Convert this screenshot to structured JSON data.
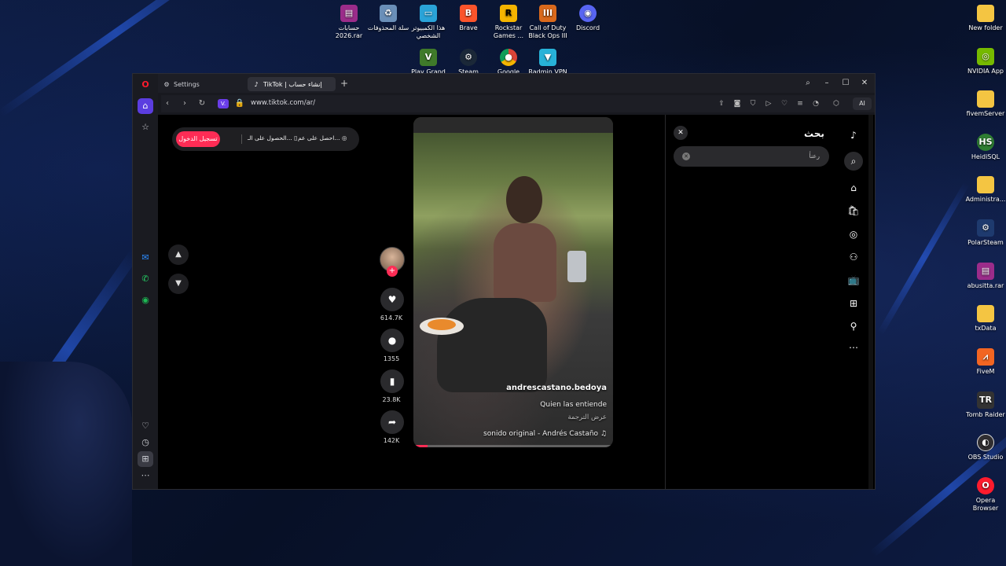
{
  "desktop": {
    "top_icons": [
      {
        "label": "حسابات 2026.rar",
        "icon": "winrar-icon",
        "color": "#9b2c8a"
      },
      {
        "label": "سلة المحذوفات",
        "icon": "recycle-bin-icon",
        "color": "#6a8fb8"
      },
      {
        "label": "هذا الكمبيوتر الشخصي",
        "icon": "this-pc-icon",
        "color": "#2aa3d8"
      },
      {
        "label": "Brave",
        "icon": "brave-icon",
        "color": "#fb542b"
      },
      {
        "label": "Rockstar Games ...",
        "icon": "rockstar-icon",
        "color": "#f5b400"
      },
      {
        "label": "Call of Duty Black Ops III",
        "icon": "cod-icon",
        "color": "#d9691c"
      },
      {
        "label": "Discord",
        "icon": "discord-icon",
        "color": "#5865f2"
      }
    ],
    "second_row_icons": [
      {
        "label": "Play Grand",
        "icon": "gta-icon",
        "color": "#3f7a2a"
      },
      {
        "label": "Steam",
        "icon": "steam-icon",
        "color": "#1b2838"
      },
      {
        "label": "Google",
        "icon": "chrome-icon",
        "color": "#db4437"
      },
      {
        "label": "Radmin VPN",
        "icon": "radmin-icon",
        "color": "#27b2d8"
      }
    ],
    "right_icons": [
      {
        "label": "New folder",
        "icon": "folder-icon",
        "color": "#f4c542"
      },
      {
        "label": "NVIDIA App",
        "icon": "nvidia-icon",
        "color": "#76b900"
      },
      {
        "label": "fivemServer",
        "icon": "folder-icon",
        "color": "#f4c542"
      },
      {
        "label": "HeidiSQL",
        "icon": "heidisql-icon",
        "color": "#2e7d32"
      },
      {
        "label": "Administra...",
        "icon": "folder-icon",
        "color": "#f4c542"
      },
      {
        "label": "PolarSteam",
        "icon": "polarsteam-icon",
        "color": "#1e3a6e"
      },
      {
        "label": "abusitta.rar",
        "icon": "winrar-icon",
        "color": "#9b2c8a"
      },
      {
        "label": "txData",
        "icon": "folder-icon",
        "color": "#f4c542"
      },
      {
        "label": "FiveM",
        "icon": "fivem-icon",
        "color": "#f26522"
      },
      {
        "label": "Tomb Raider",
        "icon": "tomb-raider-icon",
        "color": "#333333"
      },
      {
        "label": "OBS Studio",
        "icon": "obs-icon",
        "color": "#302e31"
      },
      {
        "label": "Opera Browser",
        "icon": "opera-icon",
        "color": "#ff1b2d"
      }
    ]
  },
  "browser": {
    "tabs": [
      {
        "label": "Settings",
        "icon": "gear-icon"
      },
      {
        "label": "TikTok | إنشاء حساب",
        "icon": "tiktok-icon"
      }
    ],
    "url": "www.tiktok.com/ar/",
    "url_badge": "V.",
    "ai_label": "AI"
  },
  "promo": {
    "login_label": "تسجيل الدخول",
    "item1": "الحصول على الـ...",
    "item2": "احصل على عم..."
  },
  "video": {
    "username": "andrescastano.bedoya",
    "caption": "Quien las entiende",
    "translate_label": "عرض الترجمة",
    "sound": "sonido original - Andrés Castaño",
    "progress": 0.07
  },
  "actions": {
    "likes": "614.7K",
    "comments": "1355",
    "saves": "23.8K",
    "shares": "142K"
  },
  "search": {
    "title": "بحث",
    "value": "رعنأ",
    "accent": "#fe2c55"
  }
}
